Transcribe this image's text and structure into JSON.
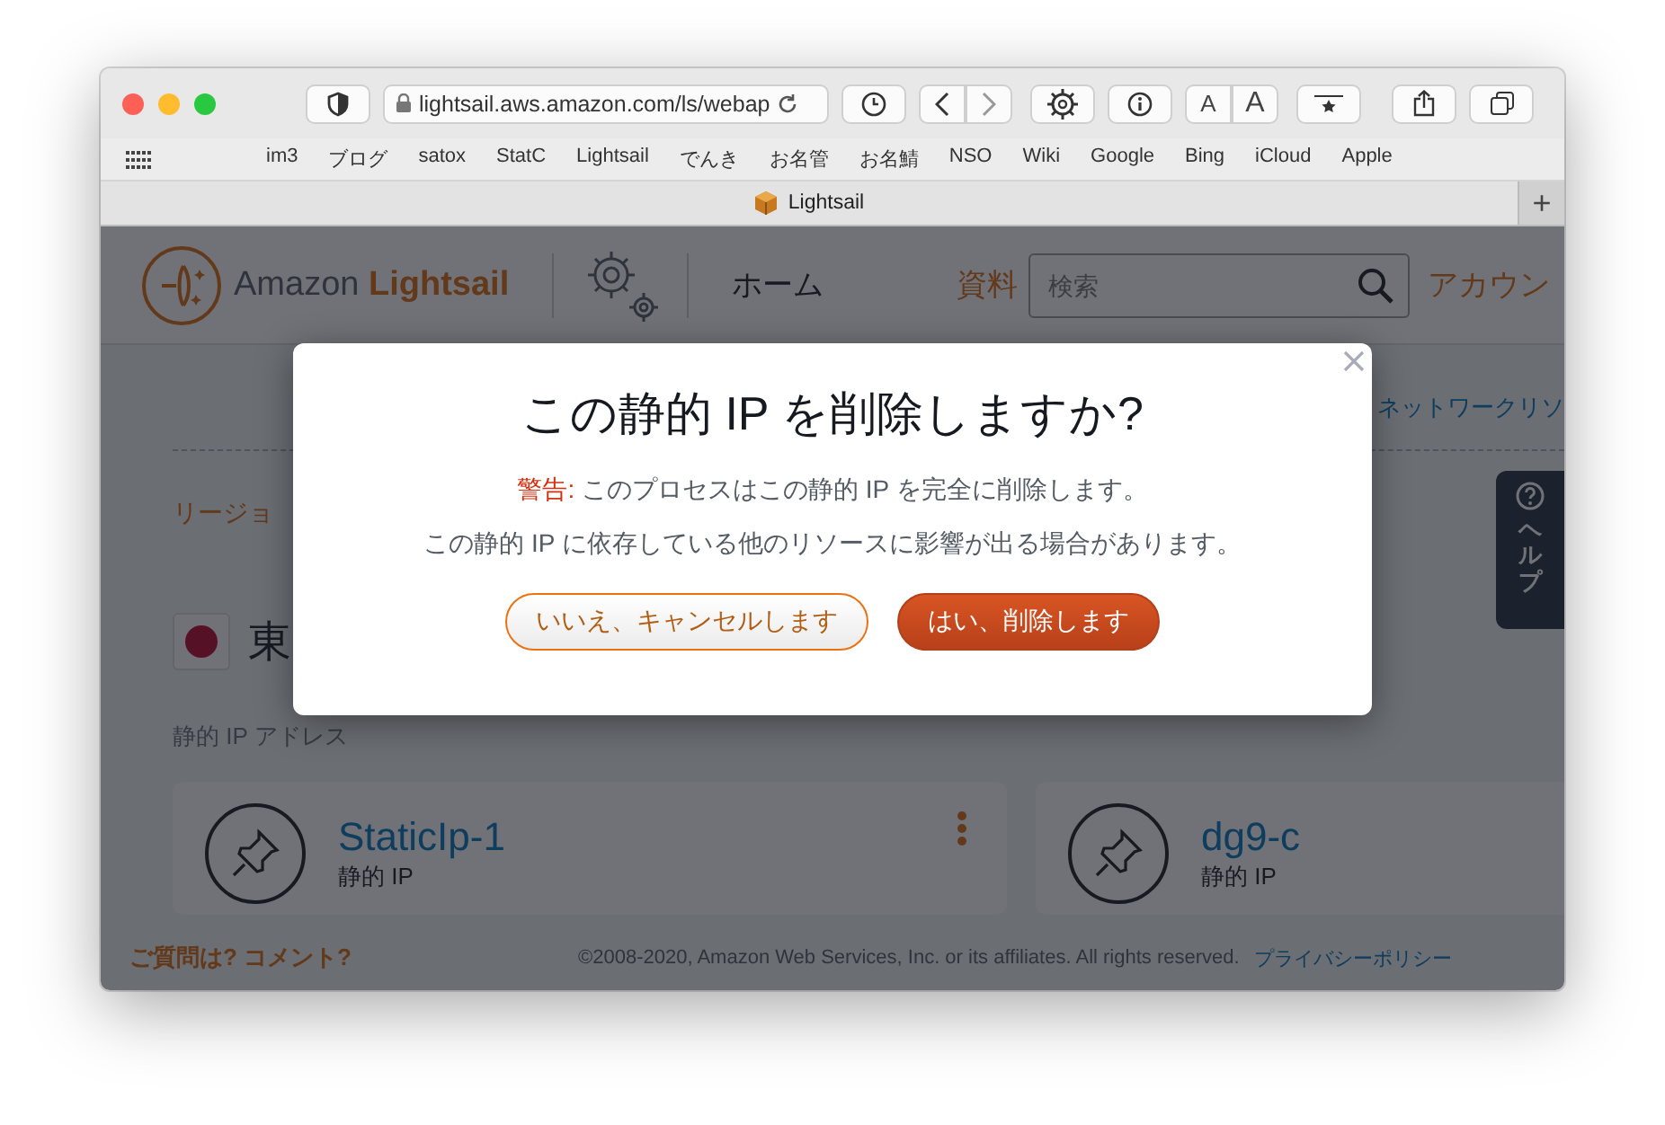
{
  "browser": {
    "url": "lightsail.aws.amazon.com/ls/webap",
    "bookmarks": [
      "im3",
      "ブログ",
      "satox",
      "StatC",
      "Lightsail",
      "でんき",
      "お名管",
      "お名鯖",
      "NSO",
      "Wiki",
      "Google",
      "Bing",
      "iCloud",
      "Apple"
    ],
    "font_buttons": [
      "A",
      "A"
    ],
    "tab": {
      "title": "Lightsail"
    },
    "new_tab": "+"
  },
  "header": {
    "brand": "Amazon",
    "brand_bold": "Lightsail",
    "nav": [
      {
        "label": "ホーム",
        "kind": "plain"
      },
      {
        "label": "資料",
        "kind": "link"
      }
    ],
    "search": {
      "placeholder": "検索"
    },
    "account": "アカウン"
  },
  "page": {
    "network_link": "ネットワークリソ",
    "region_label": "リージョ",
    "region": "東",
    "section_title": "静的 IP アドレス",
    "cards": [
      {
        "name": "StaticIp-1",
        "type": "静的 IP",
        "menu": true
      },
      {
        "name": "dg9-c",
        "type": "静的 IP",
        "menu": false
      }
    ],
    "help": "ヘルプ"
  },
  "footer": {
    "feedback": "ご質問は? コメント?",
    "copyright": "©2008-2020, Amazon Web Services, Inc. or its affiliates. All rights reserved.",
    "privacy": "プライバシーポリシー"
  },
  "dialog": {
    "title": "この静的 IP を削除しますか?",
    "warning_label": "警告:",
    "warning": "このプロセスはこの静的 IP を完全に削除します。",
    "note": "この静的 IP に依存している他のリソースに影響が出る場合があります。",
    "buttons": [
      {
        "label": "いいえ、キャンセルします",
        "kind": "secondary"
      },
      {
        "label": "はい、削除します",
        "kind": "primary"
      }
    ]
  }
}
